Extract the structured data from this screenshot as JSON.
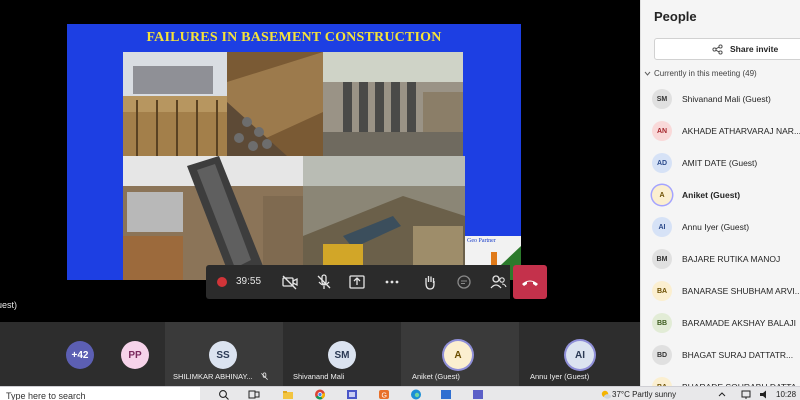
{
  "slide": {
    "title": "FAILURES IN BASEMENT CONSTRUCTION",
    "geo_partner_label": "Geo Partner"
  },
  "stage": {
    "presenter_label_fragment": "uest)"
  },
  "controls": {
    "recording_time": "39:55",
    "leave_color": "#c4314b"
  },
  "strip": {
    "overflow_count": "+42",
    "tiles": [
      {
        "initials": "PP",
        "name": ""
      },
      {
        "initials": "SS",
        "name": "SHILIMKAR ABHINAY..."
      },
      {
        "initials": "SM",
        "name": "Shivanand Mali"
      },
      {
        "initials": "A",
        "name": "Aniket (Guest)"
      },
      {
        "initials": "AI",
        "name": "Annu Iyer (Guest)"
      }
    ]
  },
  "people_panel": {
    "title": "People",
    "share_invite_label": "Share invite",
    "section_label": "Currently in this meeting (49)",
    "participants": [
      {
        "initials": "SM",
        "name": "Shivanand Mali (Guest)",
        "avatar_bg": "#e0e0e0",
        "avatar_fg": "#333333"
      },
      {
        "initials": "AN",
        "name": "AKHADE ATHARVARAJ NAR...",
        "avatar_bg": "#f9d9d9",
        "avatar_fg": "#a4262c"
      },
      {
        "initials": "AD",
        "name": "AMIT DATE (Guest)",
        "avatar_bg": "#d6e2f6",
        "avatar_fg": "#2b4a8b"
      },
      {
        "initials": "A",
        "name": "Aniket (Guest)",
        "avatar_bg": "#fbefd0",
        "avatar_fg": "#6b4e00",
        "bold": true
      },
      {
        "initials": "AI",
        "name": "Annu Iyer (Guest)",
        "avatar_bg": "#d6e2f6",
        "avatar_fg": "#2b4a8b"
      },
      {
        "initials": "BM",
        "name": "BAJARE RUTIKA MANOJ",
        "avatar_bg": "#e0e0e0",
        "avatar_fg": "#333333"
      },
      {
        "initials": "BA",
        "name": "BANARASE SHUBHAM ARVI...",
        "avatar_bg": "#fbefd0",
        "avatar_fg": "#6b4e00"
      },
      {
        "initials": "BB",
        "name": "BARAMADE AKSHAY BALAJI",
        "avatar_bg": "#e2ecd6",
        "avatar_fg": "#3b5a1c"
      },
      {
        "initials": "BD",
        "name": "BHAGAT SURAJ DATTATR...",
        "avatar_bg": "#e0e0e0",
        "avatar_fg": "#333333"
      },
      {
        "initials": "BA",
        "name": "BHARADE SOURABH DATTA...",
        "avatar_bg": "#fbefd0",
        "avatar_fg": "#6b4e00"
      }
    ]
  },
  "taskbar": {
    "search_placeholder": "Type here to search",
    "weather": "37°C  Partly sunny",
    "time": "10:28"
  }
}
